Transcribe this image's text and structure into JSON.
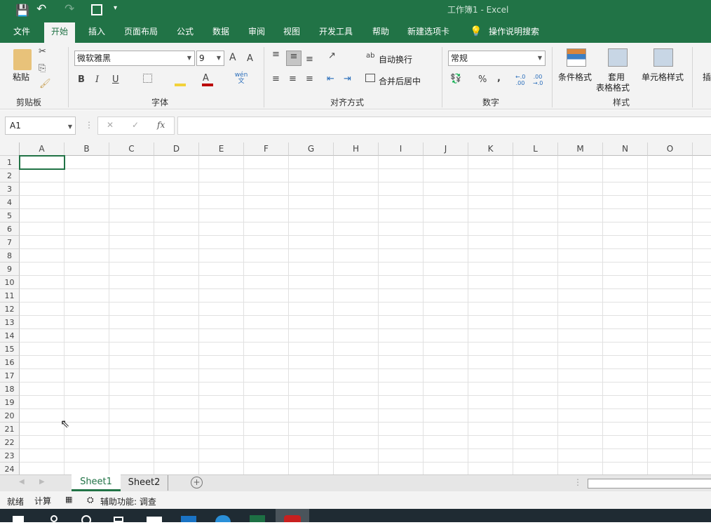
{
  "title": "工作簿1  -  Excel",
  "tabs": [
    "文件",
    "开始",
    "插入",
    "页面布局",
    "公式",
    "数据",
    "审阅",
    "视图",
    "开发工具",
    "帮助",
    "新建选项卡",
    "操作说明搜索"
  ],
  "ribbon": {
    "clipboard": {
      "paste": "粘贴",
      "group": "剪贴板"
    },
    "font": {
      "name": "微软雅黑",
      "size": "9",
      "bold": "B",
      "italic": "I",
      "underline": "U",
      "group": "字体",
      "grow": "A",
      "shrink": "A",
      "phonetic": "wén文"
    },
    "align": {
      "wrap": "自动换行",
      "merge": "合并后居中",
      "group": "对齐方式"
    },
    "number": {
      "format": "常规",
      "percent": "%",
      "comma": ",",
      "inc": "←.0 .00",
      "dec": ".00 →.0",
      "group": "数字"
    },
    "styles": {
      "cond": "条件格式",
      "table1": "套用",
      "table2": "表格格式",
      "cell": "单元格样式",
      "group": "样式"
    },
    "insert": "插"
  },
  "formula": {
    "namebox": "A1",
    "fx": "fx",
    "cancel": "✕",
    "enter": "✓",
    "value": ""
  },
  "columns": [
    "A",
    "B",
    "C",
    "D",
    "E",
    "F",
    "G",
    "H",
    "I",
    "J",
    "K",
    "L",
    "M",
    "N",
    "O"
  ],
  "rows": [
    "1",
    "2",
    "3",
    "4",
    "5",
    "6",
    "7",
    "8",
    "9",
    "10",
    "11",
    "12",
    "13",
    "14",
    "15",
    "16",
    "17",
    "18",
    "19",
    "20",
    "21",
    "22",
    "23",
    "24"
  ],
  "sheets": [
    "Sheet1",
    "Sheet2"
  ],
  "status": {
    "ready": "就绪",
    "calc": "计算",
    "access": "辅助功能: 调查"
  },
  "colors": {
    "brand": "#217346"
  }
}
